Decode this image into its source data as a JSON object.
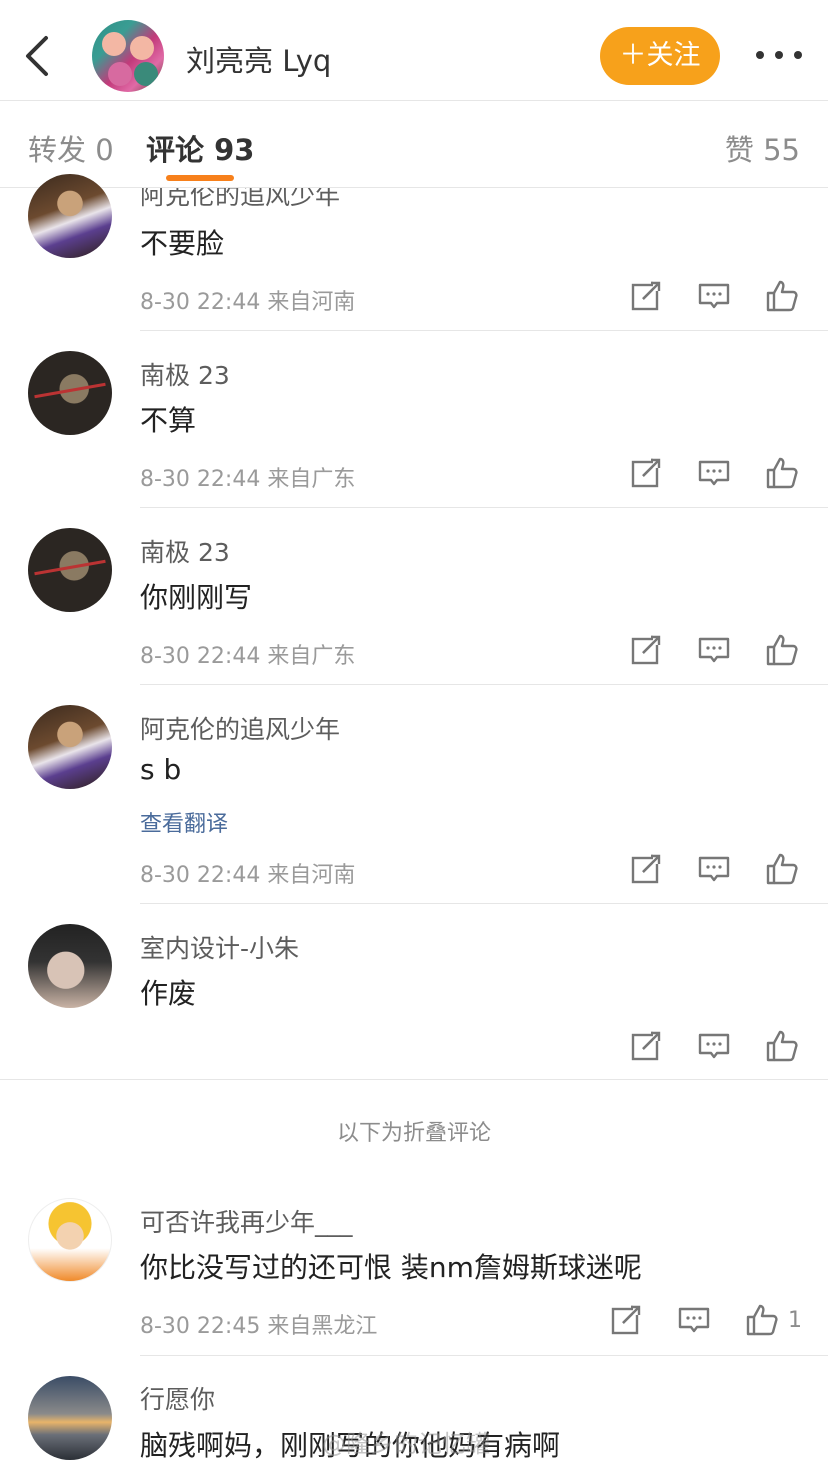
{
  "header": {
    "back_icon": "chevron-left-icon",
    "user_name": "刘亮亮 Lyq",
    "follow_label": "＋关注",
    "follow_color": "#f7a11b",
    "more_icon": "more-dots-icon"
  },
  "tabs": {
    "forward": "转发 0",
    "comments": "评论 93",
    "likes": "赞 55",
    "active_color": "#f7801b"
  },
  "comments": [
    {
      "name": "阿克伦的追风少年",
      "text": "不要脸",
      "time": "8-30 22:44",
      "location": "来自河南"
    },
    {
      "name": "南极 23",
      "text": "不算",
      "time": "8-30 22:44",
      "location": "来自广东"
    },
    {
      "name": "南极 23",
      "text": "你刚刚写",
      "time": "8-30 22:44",
      "location": "来自广东"
    },
    {
      "name": "阿克伦的追风少年",
      "text": "s b",
      "translate": "查看翻译",
      "time": "8-30 22:44",
      "location": "来自河南"
    },
    {
      "name": "室内设计-小朱",
      "text": "作废",
      "time": "",
      "location": ""
    }
  ],
  "folded_label": "以下为折叠评论",
  "folded_comments": [
    {
      "name": "可否许我再少年___",
      "text": "你比没写过的还可恨 装nm詹姆斯球迷呢",
      "time": "8-30 22:45",
      "location": "来自黑龙江",
      "likes": "1"
    },
    {
      "name": "行愿你",
      "text": "脑残啊妈，刚刚写的你他妈有病啊"
    }
  ],
  "watermark": "@隆乡的记忆罐",
  "action_icons": [
    "share-icon",
    "comment-icon",
    "like-icon"
  ]
}
